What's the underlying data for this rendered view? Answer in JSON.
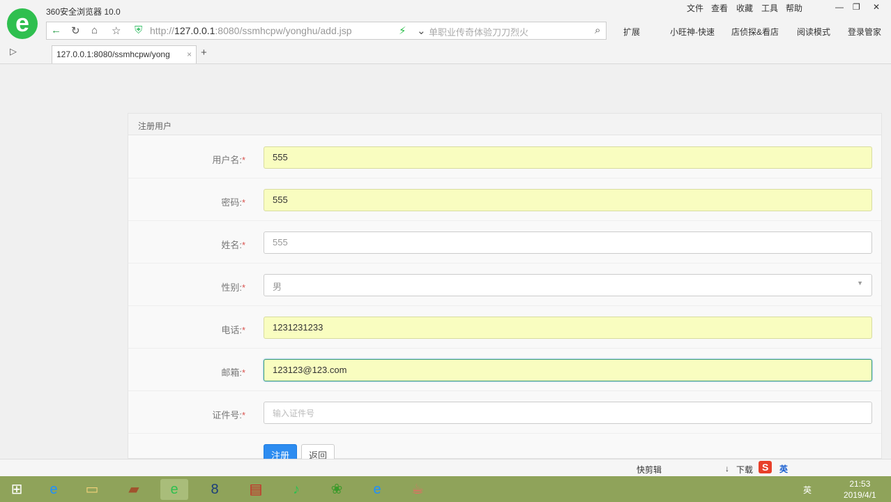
{
  "browser": {
    "title": "360安全浏览器 10.0",
    "menu": [
      "文件",
      "查看",
      "收藏",
      "工具",
      "帮助"
    ],
    "url_prefix": "http://",
    "url_host": "127.0.0.1",
    "url_rest": ":8080/ssmhcpw/yonghu/add.jsp",
    "search_placeholder": "单职业传奇体验刀刀烈火",
    "toolbar": [
      "扩展",
      "小旺神-快速",
      "店侦探&看店",
      "阅读模式",
      "登录管家"
    ],
    "tab_title": "127.0.0.1:8080/ssmhcpw/yong"
  },
  "form": {
    "heading": "注册用户",
    "required": "*",
    "fields": [
      {
        "label": "用户名:",
        "value": "555"
      },
      {
        "label": "密码:",
        "value": "555"
      },
      {
        "label": "姓名:",
        "value": "555"
      },
      {
        "label": "性别:",
        "value": "男"
      },
      {
        "label": "电话:",
        "value": "1231231233"
      },
      {
        "label": "邮箱:",
        "value": "123123@123.com"
      },
      {
        "label": "证件号:",
        "placeholder": "输入证件号"
      }
    ],
    "submit": "注册",
    "back": "返回"
  },
  "statusbar": {
    "items": [
      "快剪辑",
      "下载"
    ],
    "ime": "英"
  },
  "taskbar": {
    "time": "21:53",
    "date": "2019/4/1",
    "ime": "英"
  }
}
